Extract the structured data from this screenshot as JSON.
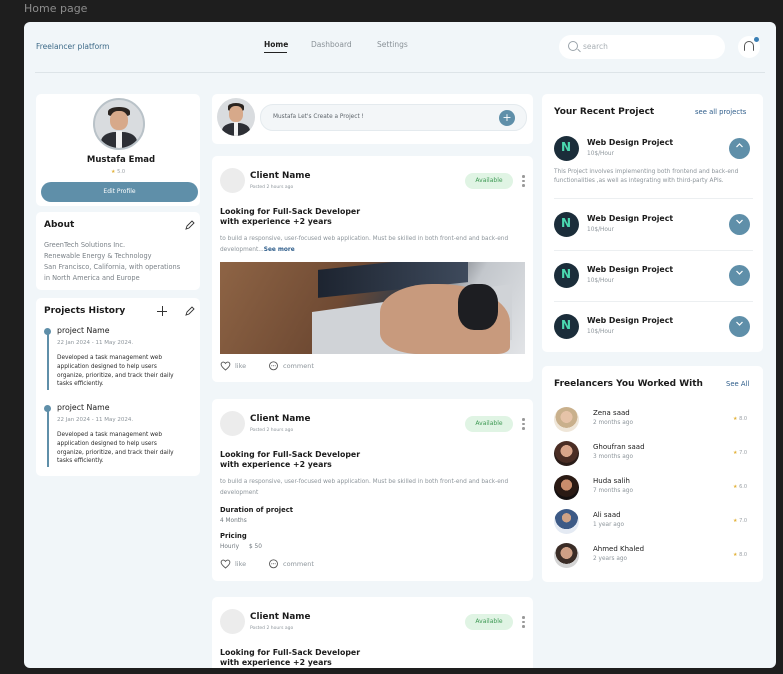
{
  "frame_title": "Home page",
  "header": {
    "brand": "Freelancer platform",
    "nav": [
      "Home",
      "Dashboard",
      "Settings"
    ],
    "search_placeholder": "search"
  },
  "profile": {
    "name": "Mustafa Emad",
    "rating": "5.0",
    "edit_label": "Edit Profile"
  },
  "about": {
    "title": "About",
    "lines": [
      "GreenTech Solutions Inc.",
      "Renewable Energy & Technology",
      "San Francisco, California, with operations",
      "in North America and Europe"
    ]
  },
  "projects_history": {
    "title": "Projects History",
    "items": [
      {
        "name": "project Name",
        "date": "22 Jan 2024 - 11 May 2024.",
        "desc": "Developed a task management web application designed to help users organize, prioritize, and track their daily tasks efficiently."
      },
      {
        "name": "project Name",
        "date": "22 Jan 2024 - 11 May 2024.",
        "desc": "Developed a task management web application designed to help users organize, prioritize, and track their daily tasks efficiently."
      }
    ]
  },
  "composer": {
    "text": "Mustafa Let's Create a Project !",
    "add": "+"
  },
  "posts": [
    {
      "client": "Client Name",
      "posted": "Posted 2 hours ago",
      "status": "Available",
      "title_1": "Looking for Full-Sack Developer",
      "title_2": "with experience +2 years",
      "desc_1": "to build a responsive, user-focused web application. Must be skilled in both front-end and back-end",
      "desc_2": "development...",
      "see_more": "See more",
      "like": "like",
      "comment": "comment"
    },
    {
      "client": "Client Name",
      "posted": "Posted 2 hours ago",
      "status": "Available",
      "title_1": "Looking for Full-Sack Developer",
      "title_2": "with experience +2 years",
      "desc_1": "to build a responsive, user-focused web application. Must be skilled in both front-end and back-end",
      "desc_2": "development",
      "duration_label": "Duration of project",
      "duration_value": "4 Months",
      "pricing_label": "Pricing",
      "pricing_type": "Hourly",
      "pricing_value": "$ 50",
      "like": "like",
      "comment": "comment"
    },
    {
      "client": "Client Name",
      "posted": "Posted 2 hours ago",
      "status": "Available",
      "title_1": "Looking for Full-Sack Developer",
      "title_2": "with experience +2 years"
    }
  ],
  "recent_projects": {
    "title": "Your Recent Project",
    "see_all": "see all projects",
    "first_desc": "This Project involves implementing both frontend and back-end functionalities ,as well as integrating with third-party APIs.",
    "items": [
      {
        "name": "Web Design Project",
        "rate": "10$/Hour",
        "expanded": true
      },
      {
        "name": "Web Design Project",
        "rate": "10$/Hour",
        "expanded": false
      },
      {
        "name": "Web Design Project",
        "rate": "10$/Hour",
        "expanded": false
      },
      {
        "name": "Web Design Project",
        "rate": "10$/Hour",
        "expanded": false
      }
    ]
  },
  "freelancers": {
    "title": "Freelancers You Worked With",
    "see_all": "See All",
    "items": [
      {
        "name": "Zena saad",
        "time": "2 months ago",
        "rating": "8.0"
      },
      {
        "name": "Ghoufran saad",
        "time": "3 months ago",
        "rating": "7.0"
      },
      {
        "name": "Huda salih",
        "time": "7 months ago",
        "rating": "6.0"
      },
      {
        "name": "Ali saad",
        "time": "1 year ago",
        "rating": "7.0"
      },
      {
        "name": "Ahmed Khaled",
        "time": "2 years ago",
        "rating": "8.0"
      }
    ]
  },
  "colors": {
    "accent": "#5f8fa9",
    "available_bg": "#e0f4e4",
    "available_text": "#3f9a55",
    "logo_bg": "#1b2d3a",
    "logo_fg": "#4bd9b0"
  }
}
